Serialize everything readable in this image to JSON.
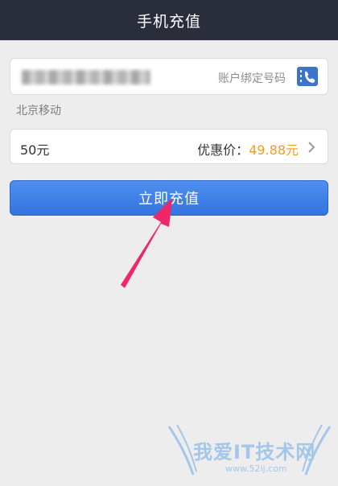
{
  "header": {
    "title": "手机充值"
  },
  "phone": {
    "hint": "账户绑定号码",
    "contact_icon": "contact-book-icon"
  },
  "carrier": "北京移动",
  "amount": {
    "label": "50元",
    "price_label": "优惠价：",
    "price_value": "49.88元"
  },
  "submit": {
    "label": "立即充值"
  },
  "watermark": {
    "text": "我爱IT技术网",
    "url": "www.52ij.com"
  },
  "colors": {
    "header_bg": "#2a2d3a",
    "button_blue": "#3c7ee6",
    "price_orange": "#f29c1f",
    "arrow_pink": "#f0266a"
  }
}
